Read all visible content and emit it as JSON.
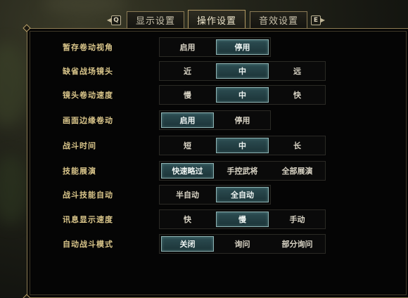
{
  "tabs": {
    "prev_key": "Q",
    "next_key": "E",
    "items": [
      {
        "label": "显示设置",
        "active": false
      },
      {
        "label": "操作设置",
        "active": true
      },
      {
        "label": "音效设置",
        "active": false
      }
    ]
  },
  "settings": [
    {
      "label": "暂存卷动视角",
      "options": [
        "启用",
        "停用"
      ],
      "selected": 1
    },
    {
      "label": "缺省战场镜头",
      "options": [
        "近",
        "中",
        "远"
      ],
      "selected": 1
    },
    {
      "label": "镜头卷动速度",
      "options": [
        "慢",
        "中",
        "快"
      ],
      "selected": 1
    },
    {
      "label": "画面边缘卷动",
      "options": [
        "启用",
        "停用"
      ],
      "selected": 0
    },
    {
      "label": "战斗时间",
      "options": [
        "短",
        "中",
        "长"
      ],
      "selected": 1
    },
    {
      "label": "技能展演",
      "options": [
        "快速略过",
        "手控武将",
        "全部展演"
      ],
      "selected": 0
    },
    {
      "label": "战斗技能自动",
      "options": [
        "半自动",
        "全自动"
      ],
      "selected": 1
    },
    {
      "label": "讯息显示速度",
      "options": [
        "快",
        "慢",
        "手动"
      ],
      "selected": 1
    },
    {
      "label": "自动战斗模式",
      "options": [
        "关闭",
        "询问",
        "部分询问"
      ],
      "selected": 0
    }
  ],
  "colors": {
    "label": "#d9c58a",
    "selected_fill": "#2c4d52",
    "selected_border": "#8eb4b4",
    "frame_border": "#8e7c53"
  }
}
